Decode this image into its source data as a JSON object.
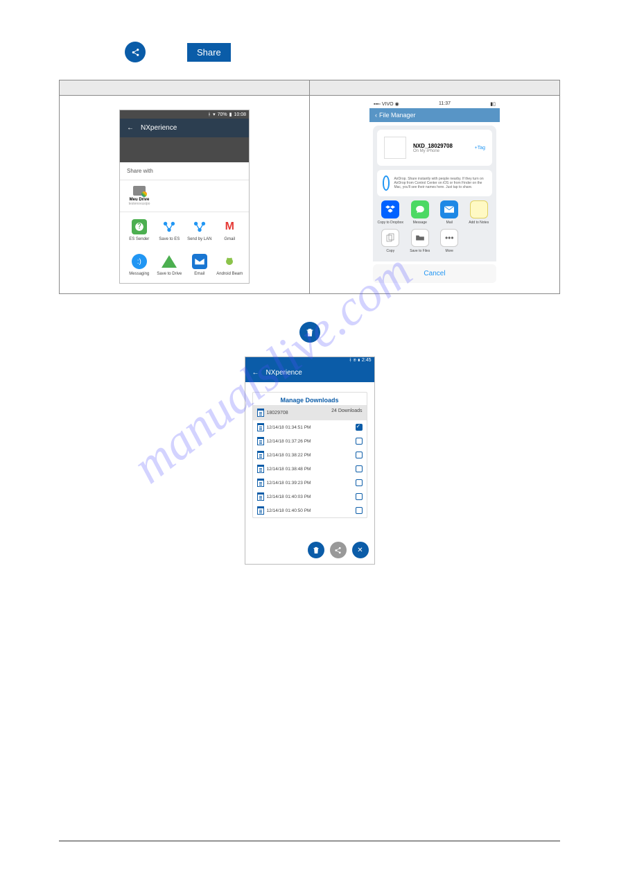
{
  "top": {
    "share_button_label": "Share"
  },
  "android_share": {
    "status": {
      "battery": "70%",
      "time": "10:08"
    },
    "app_title": "NXperience",
    "share_with_label": "Share with",
    "drive": {
      "name": "Meu Drive",
      "sub": "testenovusipo"
    },
    "apps_row1": [
      "ES Sender",
      "Save to ES",
      "Send by LAN",
      "Gmail"
    ],
    "apps_row2": [
      "Messaging",
      "Save to Drive",
      "Email",
      "Android Beam"
    ]
  },
  "ios_share": {
    "carrier": "VIVO",
    "time": "11:37",
    "nav_title": "File Manager",
    "file_name": "NXD_18029708",
    "file_location": "On My iPhone",
    "tag_label": "+Tag",
    "airdrop_text": "AirDrop. Share instantly with people nearby. If they turn on AirDrop from Control Center on iOS or from Finder on the Mac, you'll see their names here. Just tap to share.",
    "apps_row1": [
      "Copy to Dropbox",
      "Message",
      "Mail",
      "Add to Notes"
    ],
    "apps_row2": [
      "Copy",
      "Save to Files",
      "More"
    ],
    "cancel_label": "Cancel"
  },
  "downloads": {
    "status": {
      "time": "2:45"
    },
    "app_title": "NXperience",
    "section_title": "Manage Downloads",
    "device_id": "18029708",
    "download_count": "24 Downloads",
    "items": [
      {
        "ts": "12/14/18 01:34:51 PM",
        "checked": true
      },
      {
        "ts": "12/14/18 01:37:26 PM",
        "checked": false
      },
      {
        "ts": "12/14/18 01:38:22 PM",
        "checked": false
      },
      {
        "ts": "12/14/18 01:38:48 PM",
        "checked": false
      },
      {
        "ts": "12/14/18 01:39:23 PM",
        "checked": false
      },
      {
        "ts": "12/14/18 01:40:03 PM",
        "checked": false
      },
      {
        "ts": "12/14/18 01:40:50 PM",
        "checked": false
      }
    ]
  },
  "watermark": "manualslive.com"
}
